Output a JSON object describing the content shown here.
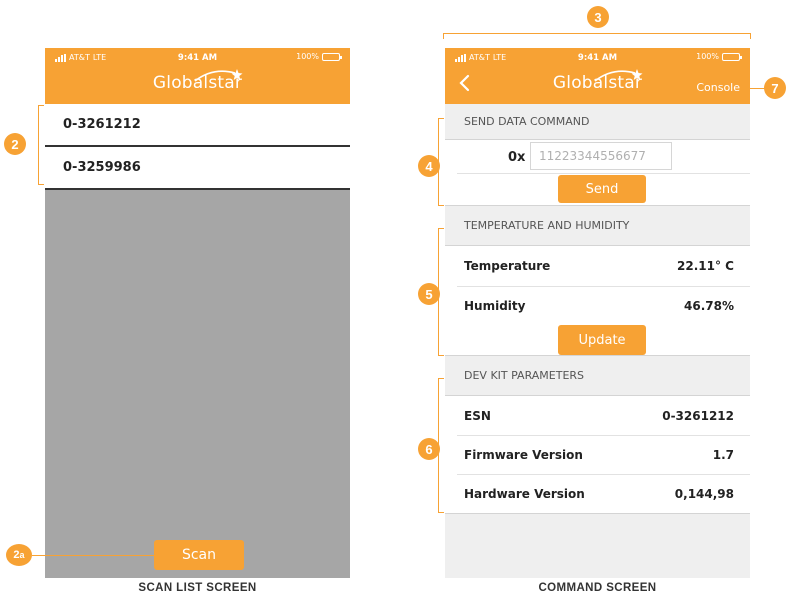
{
  "status_bar": {
    "carrier": "AT&T",
    "network": "LTE",
    "time": "9:41 AM",
    "battery": "100%"
  },
  "brand": {
    "logo_text": "Globalstar",
    "accent_color": "#f7a234"
  },
  "scan_screen": {
    "devices": [
      "0-3261212",
      "0-3259986"
    ],
    "scan_label": "Scan",
    "caption": "SCAN LIST SCREEN"
  },
  "command_screen": {
    "back_icon": "chevron-left-icon",
    "console_label": "Console",
    "send_section": {
      "title": "SEND DATA COMMAND",
      "prefix": "0x",
      "placeholder": "11223344556677",
      "send_label": "Send"
    },
    "temp_section": {
      "title": "TEMPERATURE AND HUMIDITY",
      "temperature_label": "Temperature",
      "temperature_value": "22.11° C",
      "humidity_label": "Humidity",
      "humidity_value": "46.78%",
      "update_label": "Update"
    },
    "dev_section": {
      "title": "DEV KIT PARAMETERS",
      "esn_label": "ESN",
      "esn_value": "0-3261212",
      "firmware_label": "Firmware Version",
      "firmware_value": "1.7",
      "hardware_label": "Hardware Version",
      "hardware_value": "0,144,98"
    },
    "caption": "COMMAND SCREEN"
  },
  "annotations": {
    "m2": "2",
    "m2a_num": "2",
    "m2a_sub": "a",
    "m3": "3",
    "m4": "4",
    "m5": "5",
    "m6": "6",
    "m7": "7"
  }
}
